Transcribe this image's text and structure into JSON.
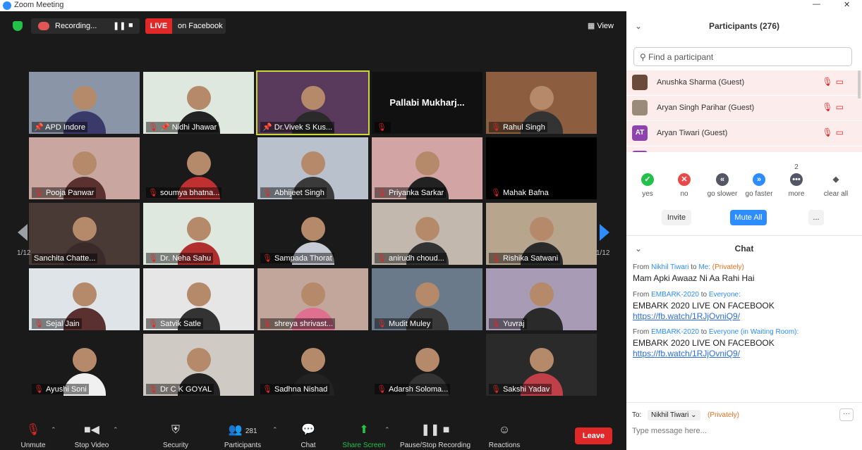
{
  "window": {
    "title": "Zoom Meeting",
    "min": "—",
    "close": "✕"
  },
  "topbar": {
    "recording_label": "Recording...",
    "pause": "❚❚",
    "stop": "■",
    "live_badge": "LIVE",
    "live_target": "on Facebook",
    "view_label": "View"
  },
  "page": {
    "left": "1/12",
    "right": "1/12"
  },
  "tiles": [
    {
      "name": "APD Indore",
      "muted": false,
      "pinned": true,
      "bg": "#8a95a8",
      "body": "#3a3a6a"
    },
    {
      "name": "Nidhi Jhawar",
      "muted": true,
      "pinned": true,
      "bg": "#dfe8de",
      "body": "#222222"
    },
    {
      "name": "Dr.Vivek S Kus...",
      "muted": false,
      "pinned": true,
      "bg": "#5a3a5c",
      "body": "#2a2a2a",
      "active": true
    },
    {
      "name": "",
      "muted": true,
      "bg": "#111111",
      "center_name": "Pallabi  Mukharj..."
    },
    {
      "name": "Rahul Singh",
      "muted": true,
      "bg": "#8c5e3f",
      "body": "#333333"
    },
    {
      "name": "Pooja Panwar",
      "muted": true,
      "bg": "#c9a7a0",
      "body": "#5a3030"
    },
    {
      "name": "soumya bhatna...",
      "muted": true,
      "bg": "#1a1a1a",
      "body": "#c03030"
    },
    {
      "name": "Abhijeet Singh",
      "muted": true,
      "bg": "#b9c2cc",
      "body": "#3a3a3a"
    },
    {
      "name": "Priyanka Sarkar",
      "muted": true,
      "bg": "#d2a4a4",
      "body": "#222222"
    },
    {
      "name": "Mahak Bafna",
      "muted": true,
      "bg": "#000000",
      "body": "#000000",
      "no_person": true
    },
    {
      "name": "Sanchita Chatte...",
      "muted": false,
      "bg": "#4a3a36",
      "body": "#3a2a2a"
    },
    {
      "name": "Dr. Neha Sahu",
      "muted": true,
      "bg": "#dfe8de",
      "body": "#b03030"
    },
    {
      "name": "Sampada Thorat",
      "muted": true,
      "bg": "#1a1a1a",
      "body": "#c8cbd6"
    },
    {
      "name": "anirudh choud...",
      "muted": true,
      "bg": "#c2b8ae",
      "body": "#333333"
    },
    {
      "name": "Rishika Satwani",
      "muted": true,
      "bg": "#b7a58e",
      "body": "#2a2a2a"
    },
    {
      "name": "Sejal Jain",
      "muted": true,
      "bg": "#dfe4e8",
      "body": "#5a3030"
    },
    {
      "name": "Satvik Satle",
      "muted": true,
      "bg": "#e6e6e6",
      "body": "#333333"
    },
    {
      "name": "shreya shrivast...",
      "muted": true,
      "bg": "#c2a69c",
      "body": "#e07090"
    },
    {
      "name": "Mudit Muley",
      "muted": true,
      "bg": "#6a7a8a",
      "body": "#3a3a3a"
    },
    {
      "name": "Yuvraj",
      "muted": true,
      "bg": "#a79bb6",
      "body": "#2a2a2a"
    },
    {
      "name": "Ayushi Soni",
      "muted": true,
      "bg": "#1a1a1a",
      "body": "#f0f0f0"
    },
    {
      "name": "Dr C K GOYAL",
      "muted": true,
      "bg": "#cfcac4",
      "body": "#222222"
    },
    {
      "name": "Sadhna Nishad",
      "muted": true,
      "bg": "#1a1a1a",
      "body": "#222222"
    },
    {
      "name": "Adarsh Soloma...",
      "muted": true,
      "bg": "#1a1a1a",
      "body": "#333333"
    },
    {
      "name": "Sakshi Yadav",
      "muted": true,
      "bg": "#2a2a2a",
      "body": "#c0404a"
    }
  ],
  "toolbar": {
    "unmute": "Unmute",
    "stop_video": "Stop Video",
    "security": "Security",
    "participants": "Participants",
    "participant_count": "281",
    "chat": "Chat",
    "share_screen": "Share Screen",
    "pause_rec": "Pause/Stop Recording",
    "reactions": "Reactions",
    "leave": "Leave"
  },
  "participants_panel": {
    "title": "Participants (276)",
    "search_placeholder": "Find a participant",
    "rows": [
      {
        "name": "Anushka Sharma (Guest)",
        "initials": "",
        "avatar_color": "#6b4a3a"
      },
      {
        "name": "Aryan Singh Parihar (Guest)",
        "initials": "",
        "avatar_color": "#9a8a7a"
      },
      {
        "name": "Aryan Tiwari (Guest)",
        "initials": "AT",
        "avatar_color": "#8e44ad"
      },
      {
        "name": "",
        "initials": "",
        "avatar_color": "#8e44ad"
      }
    ],
    "reactions": [
      {
        "label": "yes",
        "glyph": "✓",
        "color": "#23c14a",
        "count": ""
      },
      {
        "label": "no",
        "glyph": "✕",
        "color": "#e84a4a",
        "count": ""
      },
      {
        "label": "go slower",
        "glyph": "«",
        "color": "#555566",
        "count": ""
      },
      {
        "label": "go faster",
        "glyph": "»",
        "color": "#2d8cff",
        "count": ""
      },
      {
        "label": "more",
        "glyph": "•••",
        "color": "#555566",
        "count": "2"
      },
      {
        "label": "clear all",
        "glyph": "◆",
        "color": "#ffffff",
        "count": ""
      }
    ],
    "invite": "Invite",
    "mute_all": "Mute All",
    "more": "..."
  },
  "chat": {
    "title": "Chat",
    "messages": [
      {
        "from": "Nikhil Tiwari",
        "to": "Me:",
        "priv": "(Privately)",
        "lines": [
          "Mam Apki Awaaz Ni Aa Rahi Hai"
        ],
        "link": ""
      },
      {
        "from": "EMBARK-2020",
        "to": "Everyone:",
        "priv": "",
        "lines": [
          "EMBARK 2020 LIVE ON FACEBOOK"
        ],
        "link": "https://fb.watch/1RJjOvniQ9/"
      },
      {
        "from": "EMBARK-2020",
        "to": "Everyone (in Waiting Room):",
        "priv": "",
        "lines": [
          "EMBARK 2020 LIVE ON FACEBOOK"
        ],
        "link": "https://fb.watch/1RJjOvniQ9/"
      }
    ],
    "to_label": "To:",
    "to_value": "Nikhil Tiwari ⌄",
    "to_priv": "(Privately)",
    "more": "···",
    "input_placeholder": "Type message here..."
  }
}
